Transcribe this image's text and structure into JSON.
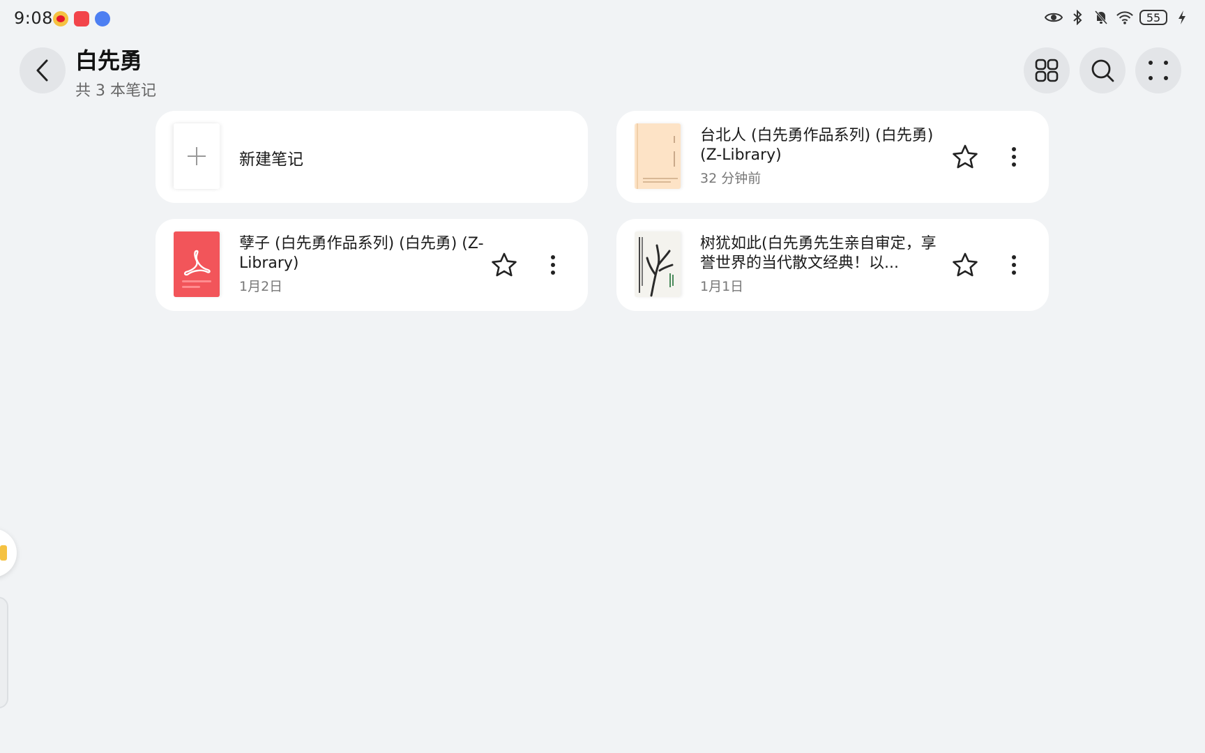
{
  "status_bar": {
    "time": "9:08",
    "notification_icons": [
      "weibo-icon",
      "app-red-icon",
      "music-icon"
    ],
    "system_icons": [
      "eye-icon",
      "bluetooth-icon",
      "mute-icon",
      "wifi-icon"
    ],
    "battery_level": "55",
    "charging": true
  },
  "header": {
    "title": "白先勇",
    "subtitle": "共 3 本笔记",
    "actions": [
      "grid-view-icon",
      "search-icon",
      "more-options-icon"
    ]
  },
  "notes": {
    "new_note_label": "新建笔记",
    "items": [
      {
        "title": "台北人 (白先勇作品系列) (白先勇) (Z-Library)",
        "time": "32 分钟前",
        "cover": "peach"
      },
      {
        "title": "孽子 (白先勇作品系列) (白先勇) (Z-Library)",
        "time": "1月2日",
        "cover": "pdf"
      },
      {
        "title": "树犹如此(白先勇先生亲自审定，享誉世界的当代散文经典！以...",
        "time": "1月1日",
        "cover": "tree"
      }
    ]
  },
  "colors": {
    "background": "#f1f3f5",
    "card": "#ffffff",
    "pdf_red": "#f2555a",
    "peach": "#fde3c6"
  }
}
